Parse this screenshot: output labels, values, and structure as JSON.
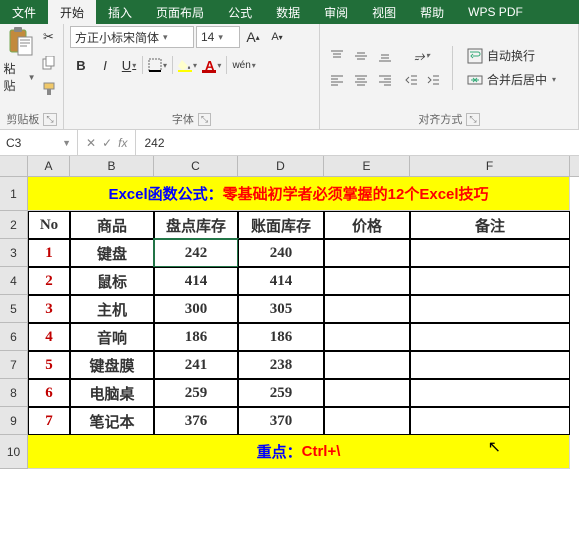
{
  "tabs": [
    "文件",
    "开始",
    "插入",
    "页面布局",
    "公式",
    "数据",
    "审阅",
    "视图",
    "帮助",
    "WPS PDF"
  ],
  "activeTab": 1,
  "ribbon": {
    "clipboard": {
      "paste": "粘贴",
      "label": "剪贴板"
    },
    "font": {
      "name": "方正小标宋简体",
      "size": "14",
      "bold": "B",
      "italic": "I",
      "underline": "U",
      "label": "字体",
      "incr": "A",
      "decr": "A",
      "wen": "wén"
    },
    "align": {
      "wrap": "自动换行",
      "merge": "合并后居中",
      "label": "对齐方式"
    }
  },
  "formula": {
    "ref": "C3",
    "fx": "fx",
    "value": "242"
  },
  "cols": [
    "A",
    "B",
    "C",
    "D",
    "E",
    "F"
  ],
  "titleParts": {
    "p1": "Excel函数公式：",
    "p2": "零基础初学者必须掌握的12个Excel技巧"
  },
  "headers": [
    "No",
    "商品",
    "盘点库存",
    "账面库存",
    "价格",
    "备注"
  ],
  "rows": [
    {
      "no": "1",
      "name": "键盘",
      "a": "242",
      "b": "240"
    },
    {
      "no": "2",
      "name": "鼠标",
      "a": "414",
      "b": "414"
    },
    {
      "no": "3",
      "name": "主机",
      "a": "300",
      "b": "305"
    },
    {
      "no": "4",
      "name": "音响",
      "a": "186",
      "b": "186"
    },
    {
      "no": "5",
      "name": "键盘膜",
      "a": "241",
      "b": "238"
    },
    {
      "no": "6",
      "name": "电脑桌",
      "a": "259",
      "b": "259"
    },
    {
      "no": "7",
      "name": "笔记本",
      "a": "376",
      "b": "370"
    }
  ],
  "footParts": {
    "p1": "重点：",
    "p2": "Ctrl+\\"
  }
}
